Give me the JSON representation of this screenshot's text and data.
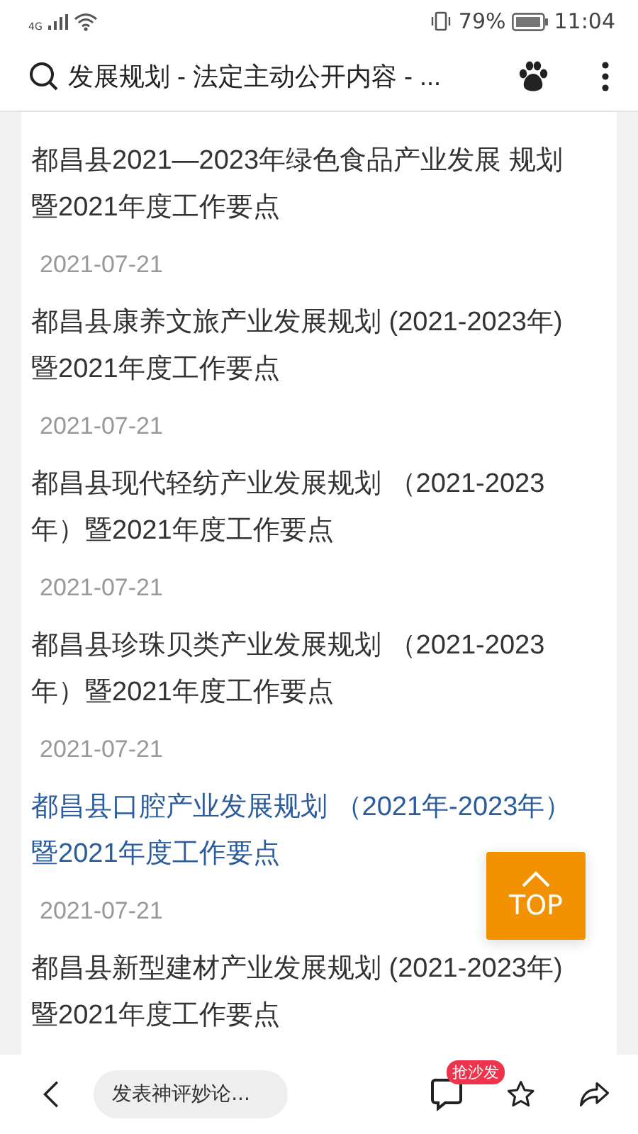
{
  "status_bar": {
    "network": "4G",
    "battery": "79%",
    "time": "11:04"
  },
  "toolbar": {
    "title": "发展规划 - 法定主动公开内容 - ..."
  },
  "articles": [
    {
      "title_lines": [
        "都昌县2021—2023年绿色食品产业发展 规划",
        "暨2021年度工作要点"
      ],
      "visited": false,
      "date": "2021-07-21"
    },
    {
      "title_lines": [
        "都昌县康养文旅产业发展规划 (2021-2023年)",
        "暨2021年度工作要点"
      ],
      "visited": false,
      "date": "2021-07-21"
    },
    {
      "title_lines": [
        "都昌县现代轻纺产业发展规划 （2021-2023",
        "年）暨2021年度工作要点"
      ],
      "visited": false,
      "date": "2021-07-21"
    },
    {
      "title_lines": [
        "都昌县珍珠贝类产业发展规划 （2021-2023",
        "年）暨2021年度工作要点"
      ],
      "visited": false,
      "date": "2021-07-21"
    },
    {
      "title_lines": [
        "都昌县口腔产业发展规划 （2021年-2023年）",
        "暨2021年度工作要点"
      ],
      "visited": true,
      "date": "2021-07-21"
    },
    {
      "title_lines": [
        "都昌县新型建材产业发展规划 (2021-2023年)",
        "暨2021年度工作要点"
      ],
      "visited": false
    }
  ],
  "top_button": {
    "label": "TOP"
  },
  "bottom_bar": {
    "comment_placeholder": "发表神评妙论...",
    "comment_badge": "抢沙发"
  }
}
